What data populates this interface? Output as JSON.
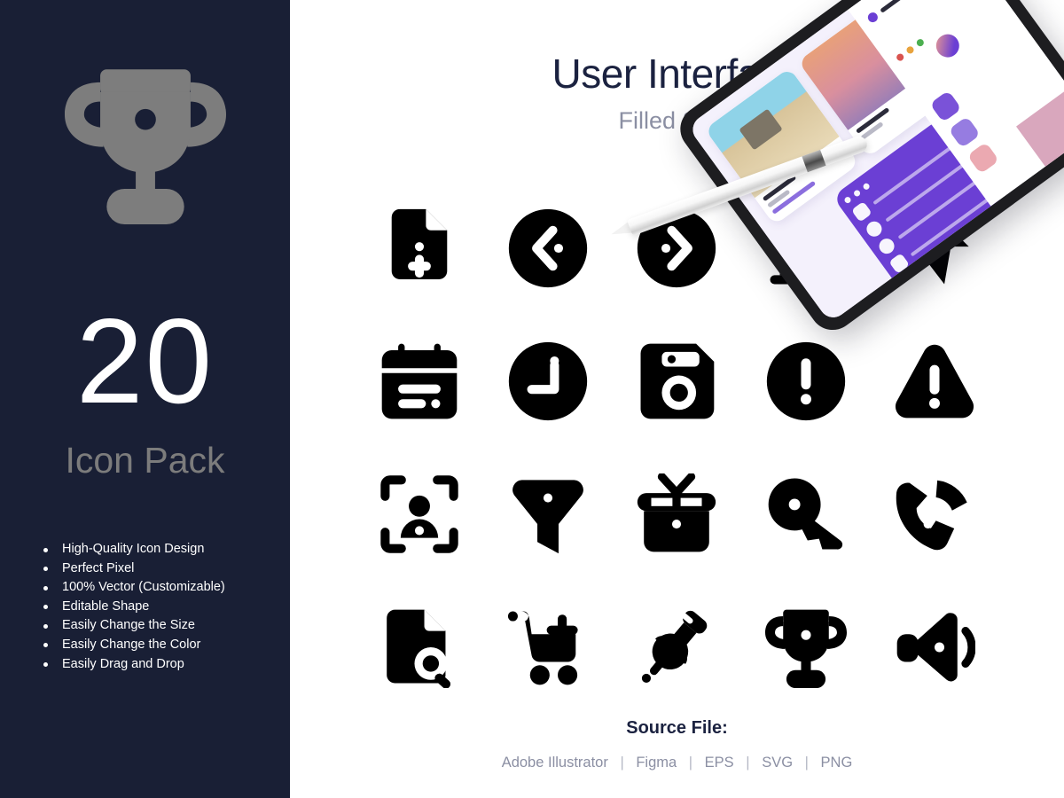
{
  "sidebar": {
    "logo_icon": "trophy-icon",
    "count": "20",
    "count_sub": "Icon Pack",
    "features": [
      "High-Quality Icon Design",
      "Perfect Pixel",
      "100% Vector (Customizable)",
      "Editable Shape",
      "Easily Change the Size",
      "Easily Change the Color",
      "Easily Drag and Drop"
    ],
    "bg_color": "#191f35",
    "logo_color": "#7d7d7d",
    "count_color": "#ffffff",
    "sub_color": "#7c7c7c"
  },
  "main": {
    "title": "User Interface",
    "subtitle": "Filled Style",
    "title_color": "#1b2240",
    "subtitle_color": "#8b8fa3",
    "icon_color": "#000000",
    "icons": [
      {
        "name": "file-plus-icon",
        "label": "File Add"
      },
      {
        "name": "circle-chevron-left-icon",
        "label": "Back"
      },
      {
        "name": "circle-chevron-right-icon",
        "label": "Forward"
      },
      {
        "name": "bank-icon",
        "label": "Bank"
      },
      {
        "name": "cursor-arrow-icon",
        "label": "Cursor"
      },
      {
        "name": "calendar-icon",
        "label": "Calendar"
      },
      {
        "name": "clock-icon",
        "label": "Clock"
      },
      {
        "name": "floppy-save-icon",
        "label": "Save"
      },
      {
        "name": "alert-circle-icon",
        "label": "Alert"
      },
      {
        "name": "warning-triangle-icon",
        "label": "Warning"
      },
      {
        "name": "face-scan-icon",
        "label": "Face Scan"
      },
      {
        "name": "filter-funnel-icon",
        "label": "Filter"
      },
      {
        "name": "gift-icon",
        "label": "Gift"
      },
      {
        "name": "key-icon",
        "label": "Key"
      },
      {
        "name": "phone-call-icon",
        "label": "Call"
      },
      {
        "name": "file-search-icon",
        "label": "File Search"
      },
      {
        "name": "cart-plus-icon",
        "label": "Add to Cart"
      },
      {
        "name": "push-pin-icon",
        "label": "Pin"
      },
      {
        "name": "trophy-icon",
        "label": "Trophy"
      },
      {
        "name": "volume-icon",
        "label": "Volume"
      }
    ]
  },
  "footer": {
    "source_label": "Source File:",
    "formats": [
      "Adobe Illustrator",
      "Figma",
      "EPS",
      "SVG",
      "PNG"
    ],
    "separator": "|"
  },
  "mockup": {
    "device": "tablet-device",
    "stylus": "stylus-pen",
    "accent_color": "#6b3fd4",
    "accent_secondary": "#d9a7bd"
  }
}
